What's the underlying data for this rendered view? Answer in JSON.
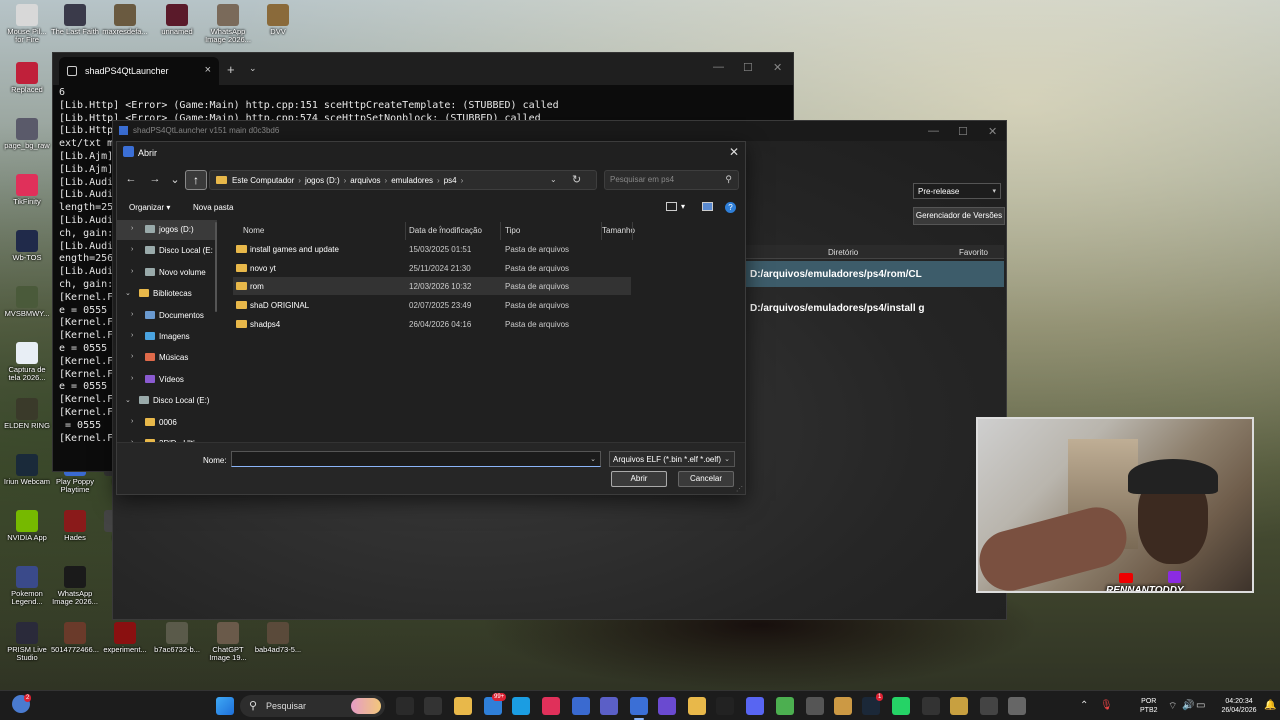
{
  "desktop": {
    "icons": [
      {
        "label": "Mouse Pil... for Fire",
        "color": "#d8d8d8"
      },
      {
        "label": "The Last Faith",
        "color": "#3a3a4a"
      },
      {
        "label": "maxresdefa...",
        "color": "#6a5a40"
      },
      {
        "label": "unnamed",
        "color": "#5a1a2a"
      },
      {
        "label": "WhatsApp Image 2026...",
        "color": "#7a6a5a"
      },
      {
        "label": "DVV",
        "color": "#8a6a3a"
      },
      {
        "label": "Replaced",
        "color": "#c0203a"
      },
      {
        "label": "page_bg_raw",
        "color": "#5a5a6a"
      },
      {
        "label": "TikFinity",
        "color": "#e0305a"
      },
      {
        "label": "Wb-TOS",
        "color": "#202a4a"
      },
      {
        "label": "MVSBMWY...",
        "color": "#4a5a3a"
      },
      {
        "label": "Captura de tela 2026...",
        "color": "#e8eef5"
      },
      {
        "label": "ELDEN RING",
        "color": "#3a3a2a"
      },
      {
        "label": "Iriun Webcam",
        "color": "#1a2a3a"
      },
      {
        "label": "Play Poppy Playtime",
        "color": "#3a6ad0"
      },
      {
        "label": "P",
        "color": "#333333"
      },
      {
        "label": "NVIDIA App",
        "color": "#76b900"
      },
      {
        "label": "Hades",
        "color": "#8a1a1a"
      },
      {
        "label": "P",
        "color": "#444444"
      },
      {
        "label": "Pokemon Legend...",
        "color": "#3a4a8a"
      },
      {
        "label": "WhatsApp Image 2026...",
        "color": "#1a1a1a"
      },
      {
        "label": "PRISM Live Studio",
        "color": "#2a2a3a"
      },
      {
        "label": "5014772466...",
        "color": "#6a3a2a"
      },
      {
        "label": "experiment...",
        "color": "#8a1010"
      },
      {
        "label": "b7ac6732-b...",
        "color": "#5a5a4a"
      },
      {
        "label": "ChatGPT Image 19...",
        "color": "#6a5a4a"
      },
      {
        "label": "bab4ad73-5...",
        "color": "#5a4a3a"
      }
    ]
  },
  "terminal": {
    "tab_title": "shadPS4QtLauncher",
    "tab_close": "×",
    "new_tab": "+",
    "tab_dropdown": "⌄",
    "controls": {
      "minimize": "—",
      "maximize": "☐",
      "close": "✕"
    },
    "lines": "6\n[Lib.Http] <Error> (Game:Main) http.cpp:151 sceHttpCreateTemplate: (STUBBED) called\n[Lib.Http] <Error> (Game:Main) http.cpp:574 sceHttpSetNonblock: (STUBBED) called\n[Lib.Http\next/txt m\n[Lib.Ajm]\n[Lib.Ajm]\n[Lib.Audi\n[Lib.Audi\nlength=25\n[Lib.Audi\nch, gain:\n[Lib.Audi\nength=256\n[Lib.Audi\nch, gain:\n[Kernel.F\ne = 0555\n[Kernel.F\n[Kernel.F\ne = 0555\n[Kernel.F\n[Kernel.F\ne = 0555\n[Kernel.F\n[Kernel.F\n = 0555\n[Kernel.F\n"
  },
  "launcher": {
    "title": "shadPS4QtLauncher v151 main d0c3bd6",
    "controls": {
      "minimize": "—",
      "maximize": "☐",
      "close": "✕"
    },
    "release_channel": "Pre-release",
    "versions_button": "Gerenciador de Versões",
    "table": {
      "col_directory": "Diretório",
      "col_favorite": "Favorito",
      "rows": [
        "D:/arquivos/emuladores/ps4/rom/CL",
        "D:/arquivos/emuladores/ps4/install g"
      ]
    }
  },
  "dialog": {
    "title": "Abrir",
    "close": "✕",
    "nav": {
      "back": "←",
      "forward": "→",
      "recent": "⌄",
      "up": "↑"
    },
    "breadcrumb": [
      "Este Computador",
      "jogos (D:)",
      "arquivos",
      "emuladores",
      "ps4"
    ],
    "breadcrumb_sep": "›",
    "address_caret": "⌄",
    "refresh": "↻",
    "search_placeholder": "Pesquisar em ps4",
    "search_glyph": "⚲",
    "toolbar": {
      "organize": "Organizar ▾",
      "new_folder": "Nova pasta",
      "help": "?"
    },
    "nav_pane": [
      {
        "label": "jogos (D:)",
        "icon": "drive",
        "selected": true,
        "indent": 1,
        "expander": "›"
      },
      {
        "label": "Disco Local (E:",
        "icon": "drive",
        "selected": false,
        "indent": 1,
        "expander": "›"
      },
      {
        "label": "Novo volume",
        "icon": "drive",
        "selected": false,
        "indent": 1,
        "expander": "›"
      },
      {
        "label": "Bibliotecas",
        "icon": "folder",
        "selected": false,
        "indent": 0,
        "expander": "⌄"
      },
      {
        "label": "Documentos",
        "icon": "docs",
        "selected": false,
        "indent": 1,
        "expander": "›"
      },
      {
        "label": "Imagens",
        "icon": "pictures",
        "selected": false,
        "indent": 1,
        "expander": "›"
      },
      {
        "label": "Músicas",
        "icon": "music",
        "selected": false,
        "indent": 1,
        "expander": "›"
      },
      {
        "label": "Vídeos",
        "icon": "videos",
        "selected": false,
        "indent": 1,
        "expander": "›"
      },
      {
        "label": "Disco Local (E:)",
        "icon": "drive",
        "selected": false,
        "indent": 0,
        "expander": "⌄"
      },
      {
        "label": "0006",
        "icon": "folder",
        "selected": false,
        "indent": 1,
        "expander": "›"
      },
      {
        "label": "2D'D...Ulti...",
        "icon": "folder",
        "selected": false,
        "indent": 1,
        "expander": "›"
      }
    ],
    "columns": {
      "name": "Nome",
      "modified": "Data de modificação",
      "type": "Tipo",
      "size": "Tamanho"
    },
    "sort_glyph": "^",
    "files": [
      {
        "name": "install games and update",
        "modified": "15/03/2025 01:51",
        "type": "Pasta de arquivos",
        "selected": false
      },
      {
        "name": "novo yt",
        "modified": "25/11/2024 21:30",
        "type": "Pasta de arquivos",
        "selected": false
      },
      {
        "name": "rom",
        "modified": "12/03/2026 10:32",
        "type": "Pasta de arquivos",
        "selected": true
      },
      {
        "name": "shaD ORIGINAL",
        "modified": "02/07/2025 23:49",
        "type": "Pasta de arquivos",
        "selected": false
      },
      {
        "name": "shadps4",
        "modified": "26/04/2026 04:16",
        "type": "Pasta de arquivos",
        "selected": false
      }
    ],
    "footer": {
      "name_label": "Nome:",
      "name_value": "",
      "filter": "Arquivos ELF (*.bin *.elf *.oelf)",
      "open_button": "Abrir",
      "cancel_button": "Cancelar",
      "caret": "⌄",
      "grip": "⋰"
    }
  },
  "webcam": {
    "overlay_text": "RENNANTODDY"
  },
  "taskbar": {
    "search_label": "Pesquisar",
    "search_glyph": "⚲",
    "weather_badge": "2",
    "mail_badge": "99+",
    "whatsapp_badge": "1",
    "language": "POR",
    "keyboard": "PTB2",
    "time": "04:20:34",
    "date": "26/04/2026",
    "tray_chevron": "⌃",
    "mic": "🎙",
    "wifi": "⌔",
    "volume": "🔊",
    "battery": "▭",
    "bell": "🔔"
  },
  "colors": {
    "accent": "#8ab4f8",
    "folder": "#e8b84a",
    "selection": "#3d5c6a"
  }
}
